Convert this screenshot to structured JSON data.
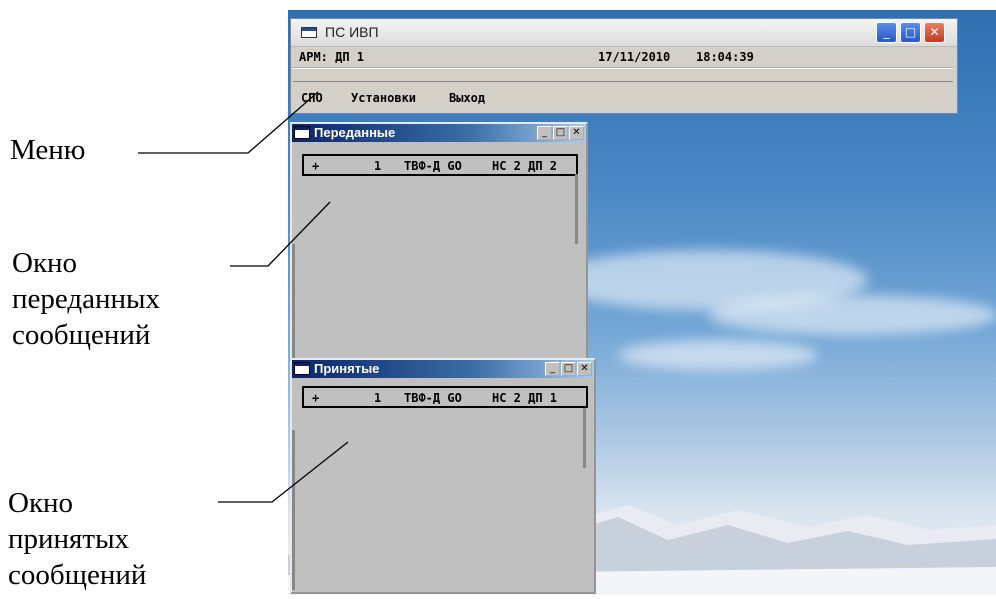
{
  "main_window": {
    "title": "ПС ИВП",
    "status_left": "АРМ: ДП 1",
    "status_date": "17/11/2010",
    "status_time": "18:04:39",
    "menu": [
      "СПО",
      "Установки",
      "Выход"
    ],
    "controls": {
      "minimize": "_",
      "maximize": "□",
      "close": "✕"
    }
  },
  "sent_window": {
    "title": "Переданные",
    "row": {
      "marker": "+",
      "num": "1",
      "text": "ТВФ-Д GO",
      "from": "НС 2 ДП 2"
    },
    "controls": {
      "minimize": "_",
      "maximize": "□",
      "close": "✕"
    }
  },
  "received_window": {
    "title": "Принятые",
    "row": {
      "marker": "+",
      "num": "1",
      "text": "ТВФ-Д GO",
      "from": "НС 2 ДП 1"
    },
    "controls": {
      "minimize": "_",
      "maximize": "□",
      "close": "✕"
    }
  },
  "annotations": {
    "menu": "Меню",
    "sent": [
      "Окно",
      "переданных",
      "сообщений"
    ],
    "received": [
      "Окно",
      "принятых",
      "сообщений"
    ]
  }
}
